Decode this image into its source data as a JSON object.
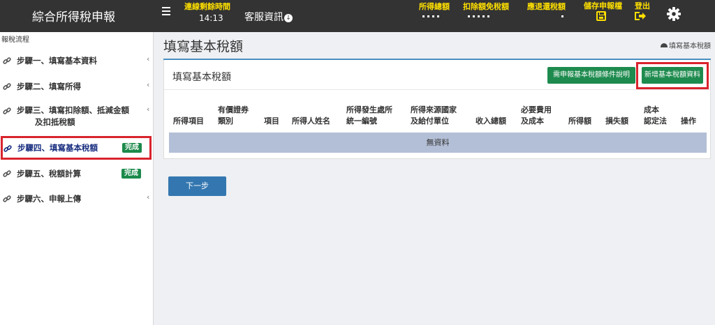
{
  "header": {
    "title": "綜合所得稅申報",
    "timer_label": "連線剩餘時間",
    "timer_value": "14:13",
    "service_label": "客服資訊",
    "stats": [
      {
        "label": "所得總額"
      },
      {
        "label": "扣除額免稅額"
      },
      {
        "label": "應退還稅額"
      }
    ],
    "save_label": "儲存申報檔",
    "logout_label": "登出",
    "accent_color": "#ffe000",
    "bar_color": "#333333"
  },
  "sidebar": {
    "header": "報稅流程",
    "items": [
      {
        "label": "步驟一、填寫基本資料",
        "badge": ""
      },
      {
        "label": "步驟二、填寫所得",
        "badge": ""
      },
      {
        "label": "步驟三、填寫扣除額、抵減金額",
        "label2": "及扣抵稅額",
        "badge": ""
      },
      {
        "label": "步驟四、填寫基本稅額",
        "badge": "完成"
      },
      {
        "label": "步驟五、稅額計算",
        "badge": "完成"
      },
      {
        "label": "步驟六、申報上傳",
        "badge": ""
      }
    ],
    "icons": {
      "link": "link-icon",
      "chevron": "chevron-left-icon"
    }
  },
  "main": {
    "page_title": "填寫基本稅額",
    "breadcrumb": "填寫基本稅額",
    "panel_title": "填寫基本稅額",
    "help_button": "需申報基本稅額條件說明",
    "add_button": "新增基本稅額資料",
    "table": {
      "columns": [
        {
          "l1": "所得項目",
          "l2": ""
        },
        {
          "l1": "有價證券",
          "l2": "類別"
        },
        {
          "l1": "項目",
          "l2": ""
        },
        {
          "l1": "所得人姓名",
          "l2": ""
        },
        {
          "l1": "所得發生處所",
          "l2": "統一編號"
        },
        {
          "l1": "所得來源國家",
          "l2": "及給付單位"
        },
        {
          "l1": "收入總額",
          "l2": ""
        },
        {
          "l1": "必要費用",
          "l2": "及成本"
        },
        {
          "l1": "所得額",
          "l2": ""
        },
        {
          "l1": "損失額",
          "l2": ""
        },
        {
          "l1": "成本",
          "l2": "認定法"
        },
        {
          "l1": "操作",
          "l2": ""
        }
      ],
      "empty_text": "無資料"
    },
    "next_button": "下一步"
  }
}
